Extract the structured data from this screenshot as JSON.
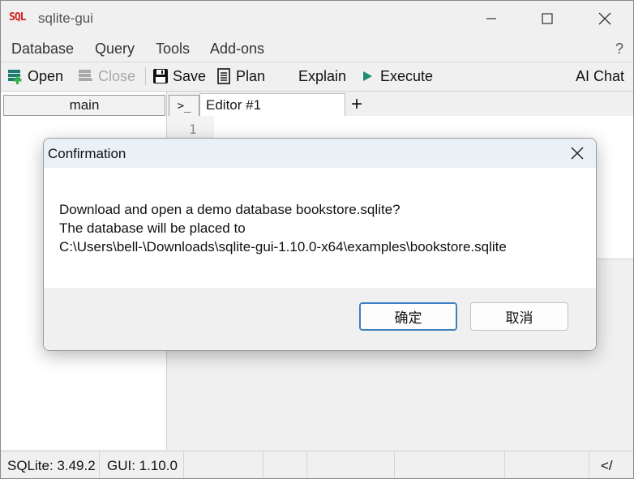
{
  "window": {
    "logo": "SQL",
    "title": "sqlite-gui"
  },
  "menu": {
    "items": [
      "Database",
      "Query",
      "Tools",
      "Add-ons"
    ],
    "help": "?"
  },
  "toolbar": {
    "open": "Open",
    "close": "Close",
    "save": "Save",
    "plan": "Plan",
    "explain": "Explain",
    "execute": "Execute",
    "ai_chat": "AI Chat"
  },
  "left_panel": {
    "tab": "main"
  },
  "editor": {
    "shell_tab": ">_",
    "tab_label": "Editor #1",
    "add_tab": "+",
    "line_number": "1"
  },
  "status": {
    "sqlite": "SQLite: 3.49.2",
    "gui": "GUI: 1.10.0",
    "end": "</"
  },
  "dialog": {
    "title": "Confirmation",
    "message_line1": "Download and open a demo database bookstore.sqlite?",
    "message_line2": "The database will be placed to",
    "message_line3": "C:\\Users\\bell-\\Downloads\\sqlite-gui-1.10.0-x64\\examples\\bookstore.sqlite",
    "ok_button": "确定",
    "cancel_button": "取消"
  },
  "colors": {
    "logo_red": "#d21e1e",
    "dialog_title_bg": "#eaf1f6",
    "primary_border": "#3d7fc1",
    "execute_green": "#1e8c6e"
  }
}
